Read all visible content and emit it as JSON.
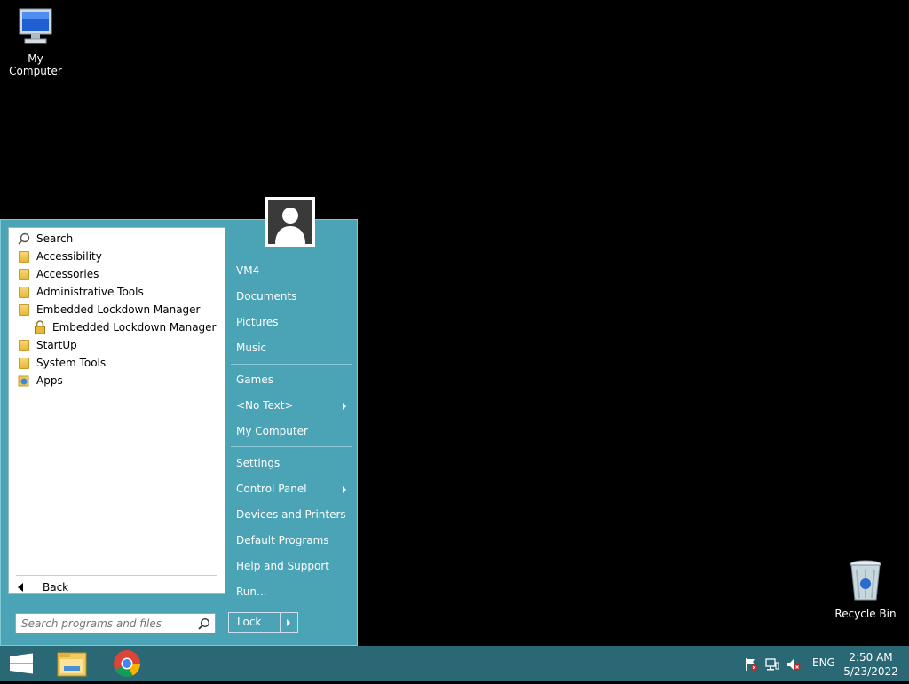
{
  "desktop": {
    "icons": [
      {
        "label": "My Computer"
      },
      {
        "label": "Recycle Bin"
      }
    ]
  },
  "start_menu": {
    "programs": [
      {
        "label": "Search",
        "icon": "search-icon"
      },
      {
        "label": "Accessibility",
        "icon": "folder-icon"
      },
      {
        "label": "Accessories",
        "icon": "folder-icon"
      },
      {
        "label": "Administrative Tools",
        "icon": "folder-icon"
      },
      {
        "label": "Embedded Lockdown Manager",
        "icon": "folder-icon"
      },
      {
        "label": "Embedded Lockdown Manager",
        "icon": "lock-icon"
      },
      {
        "label": "StartUp",
        "icon": "folder-icon"
      },
      {
        "label": "System Tools",
        "icon": "folder-icon"
      },
      {
        "label": "Apps",
        "icon": "apps-folder-icon"
      }
    ],
    "back_label": "Back",
    "search_placeholder": "Search programs and files",
    "right_items": [
      {
        "label": "VM4"
      },
      {
        "label": "Documents"
      },
      {
        "label": "Pictures"
      },
      {
        "label": "Music"
      },
      {
        "label": "Games"
      },
      {
        "label": "<No Text>"
      },
      {
        "label": "My Computer"
      },
      {
        "label": "Settings"
      },
      {
        "label": "Control Panel"
      },
      {
        "label": "Devices and Printers"
      },
      {
        "label": "Default Programs"
      },
      {
        "label": "Help and Support"
      },
      {
        "label": "Run..."
      }
    ],
    "lock_label": "Lock"
  },
  "taskbar": {
    "language": "ENG",
    "time": "2:50 AM",
    "date": "5/23/2022"
  },
  "colors": {
    "menu_bg": "#4ba3b6",
    "taskbar_bg": "#2a6875",
    "desktop_bg": "#000000"
  }
}
